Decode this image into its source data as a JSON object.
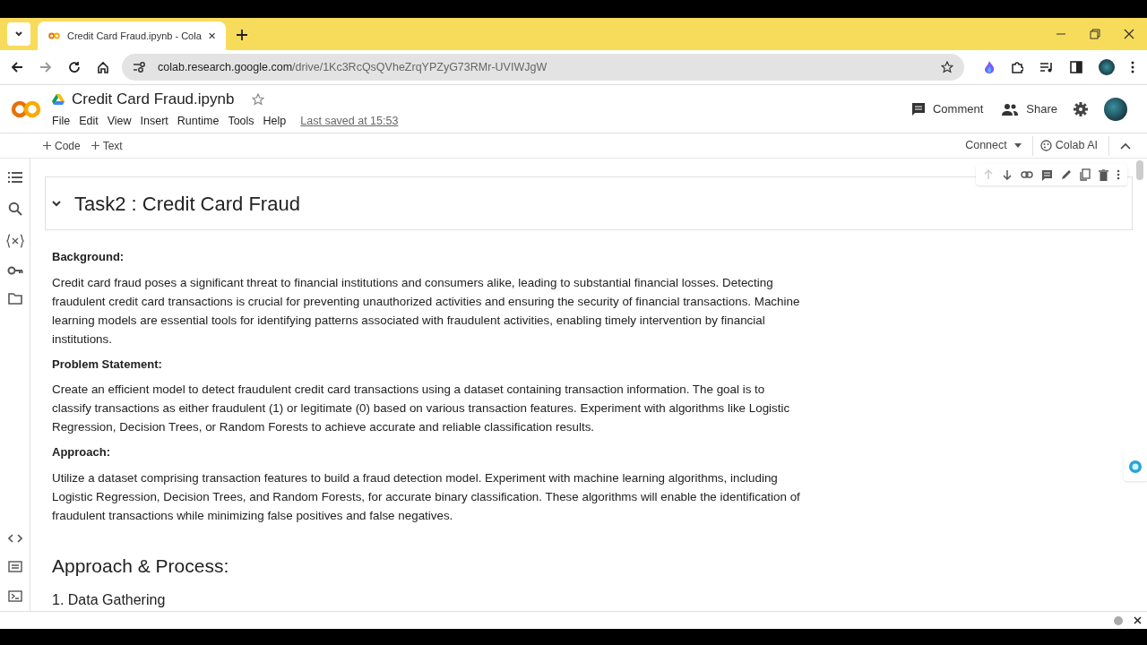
{
  "browser": {
    "tab": {
      "title": "Credit Card Fraud.ipynb - Cola",
      "selected": true
    },
    "url_host": "colab.research.google.com",
    "url_path": "/drive/1Kc3RcQsQVheZrqYPZyG73RMr-UVIWJgW"
  },
  "notebook": {
    "title": "Credit Card Fraud.ipynb",
    "menu": [
      "File",
      "Edit",
      "View",
      "Insert",
      "Runtime",
      "Tools",
      "Help"
    ],
    "last_saved": "Last saved at 15:53"
  },
  "header_actions": [
    "Comment",
    "Share"
  ],
  "toolbar": {
    "add_buttons": [
      "Code",
      "Text"
    ],
    "connect": "Connect",
    "ai": "Colab AI"
  },
  "sections": [
    {
      "kind": "heading",
      "text": "Task2 : Credit Card Fraud",
      "expanded": true
    },
    {
      "kind": "label",
      "text": "Background:"
    },
    {
      "kind": "paragraph",
      "text": "Credit card fraud poses a significant threat to financial institutions and consumers alike, leading to substantial financial losses. Detecting fraudulent credit card transactions is crucial for preventing unauthorized activities and ensuring the security of financial transactions. Machine learning models are essential tools for identifying patterns associated with fraudulent activities, enabling timely intervention by financial institutions."
    },
    {
      "kind": "label",
      "text": "Problem Statement:"
    },
    {
      "kind": "paragraph",
      "text": "Create an efficient model to detect fraudulent credit card transactions using a dataset containing transaction information. The goal is to classify transactions as either fraudulent (1) or legitimate (0) based on various transaction features. Experiment with algorithms like Logistic Regression, Decision Trees, or Random Forests to achieve accurate and reliable classification results."
    },
    {
      "kind": "label",
      "text": "Approach:"
    },
    {
      "kind": "paragraph",
      "text": "Utilize a dataset comprising transaction features to build a fraud detection model. Experiment with machine learning algorithms, including Logistic Regression, Decision Trees, and Random Forests, for accurate binary classification. These algorithms will enable the identification of fraudulent transactions while minimizing false positives and false negatives."
    },
    {
      "kind": "subheading",
      "text": "Approach & Process:"
    },
    {
      "kind": "item",
      "text": "1. Data Gathering"
    }
  ]
}
